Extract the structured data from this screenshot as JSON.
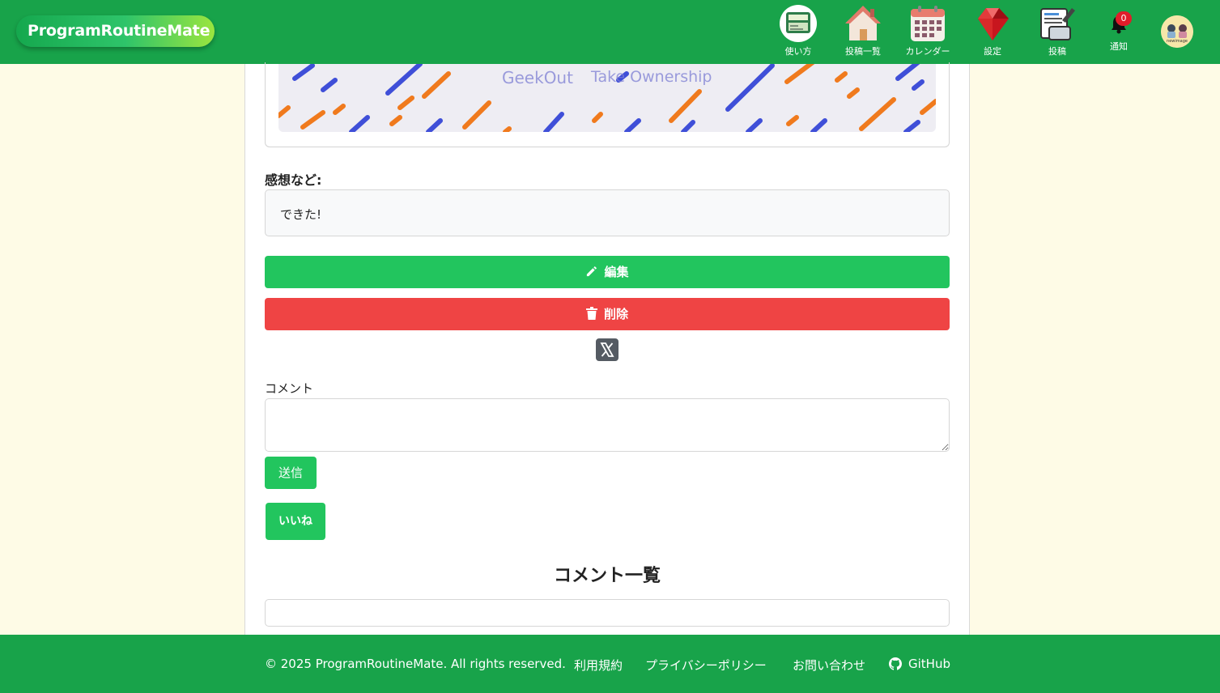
{
  "header": {
    "brand": "ProgramRoutineMate",
    "nav": [
      {
        "label": "使い方",
        "icon": "book-icon"
      },
      {
        "label": "投稿一覧",
        "icon": "house-icon"
      },
      {
        "label": "カレンダー",
        "icon": "calendar-icon"
      },
      {
        "label": "設定",
        "icon": "ruby-gem-icon"
      },
      {
        "label": "投稿",
        "icon": "post-edit-icon"
      }
    ],
    "notifications": {
      "label": "通知",
      "count": "0",
      "icon": "bell-icon"
    },
    "avatar": {
      "text": "newimage",
      "icon": "avatar-icon"
    }
  },
  "post": {
    "banner_text_1": "GeekOut",
    "banner_text_2": "Take Ownership",
    "impression_label": "感想など:",
    "impression_value": "できた!",
    "edit_label": "編集",
    "delete_label": "削除",
    "share_icon": "x-logo-icon"
  },
  "comment_form": {
    "label": "コメント",
    "placeholder": "",
    "send_label": "送信",
    "like_label": "いいね"
  },
  "comments": {
    "title": "コメント一覧"
  },
  "footer": {
    "copyright": "© 2025 ProgramRoutineMate. All rights reserved.",
    "terms": "利用規約",
    "privacy": "プライバシーポリシー",
    "contact": "お問い合わせ",
    "github": "GitHub"
  },
  "colors": {
    "header_green": "#18a34a",
    "button_green": "#22c55e",
    "delete_red": "#ef4444",
    "page_bg": "#fefbe6"
  }
}
